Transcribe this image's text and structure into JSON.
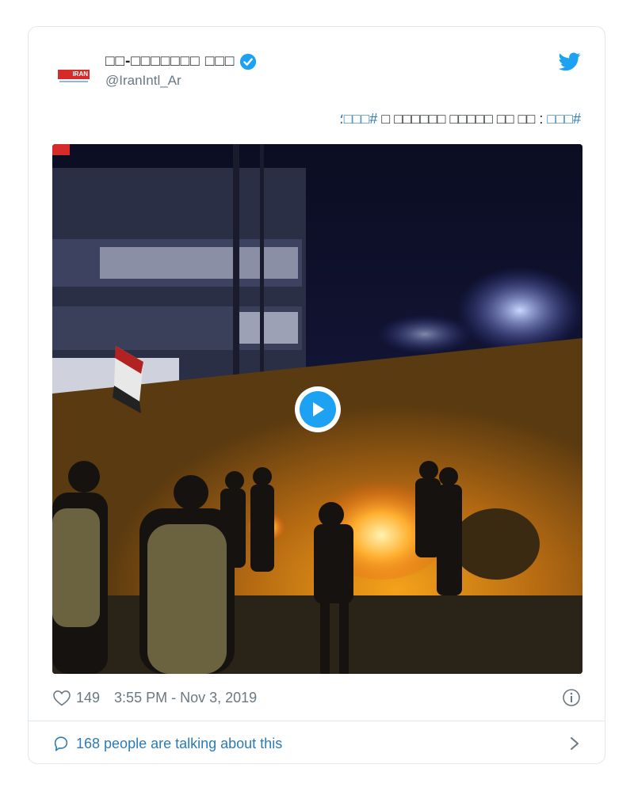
{
  "tweet": {
    "author": {
      "display_name": "□□-□□□□□□□ □□□",
      "handle": "@IranIntl_Ar",
      "verified": true,
      "avatar_logo_text": "IRAN"
    },
    "text": {
      "hashtag_start": "#□□□",
      "body": ": □□ □□ □□□□□ □□□□□□ □",
      "hashtag_end": "#□□□",
      "trailing": "؛"
    },
    "media": {
      "type": "video",
      "play_label": "Play video"
    },
    "likes": "149",
    "timestamp": "3:55 PM - Nov 3, 2019",
    "conversation": "168 people are talking about this"
  },
  "colors": {
    "link": "#2b7bb9",
    "twitter_blue": "#1da1f2",
    "muted": "#697882",
    "border": "#e1e8ed"
  }
}
